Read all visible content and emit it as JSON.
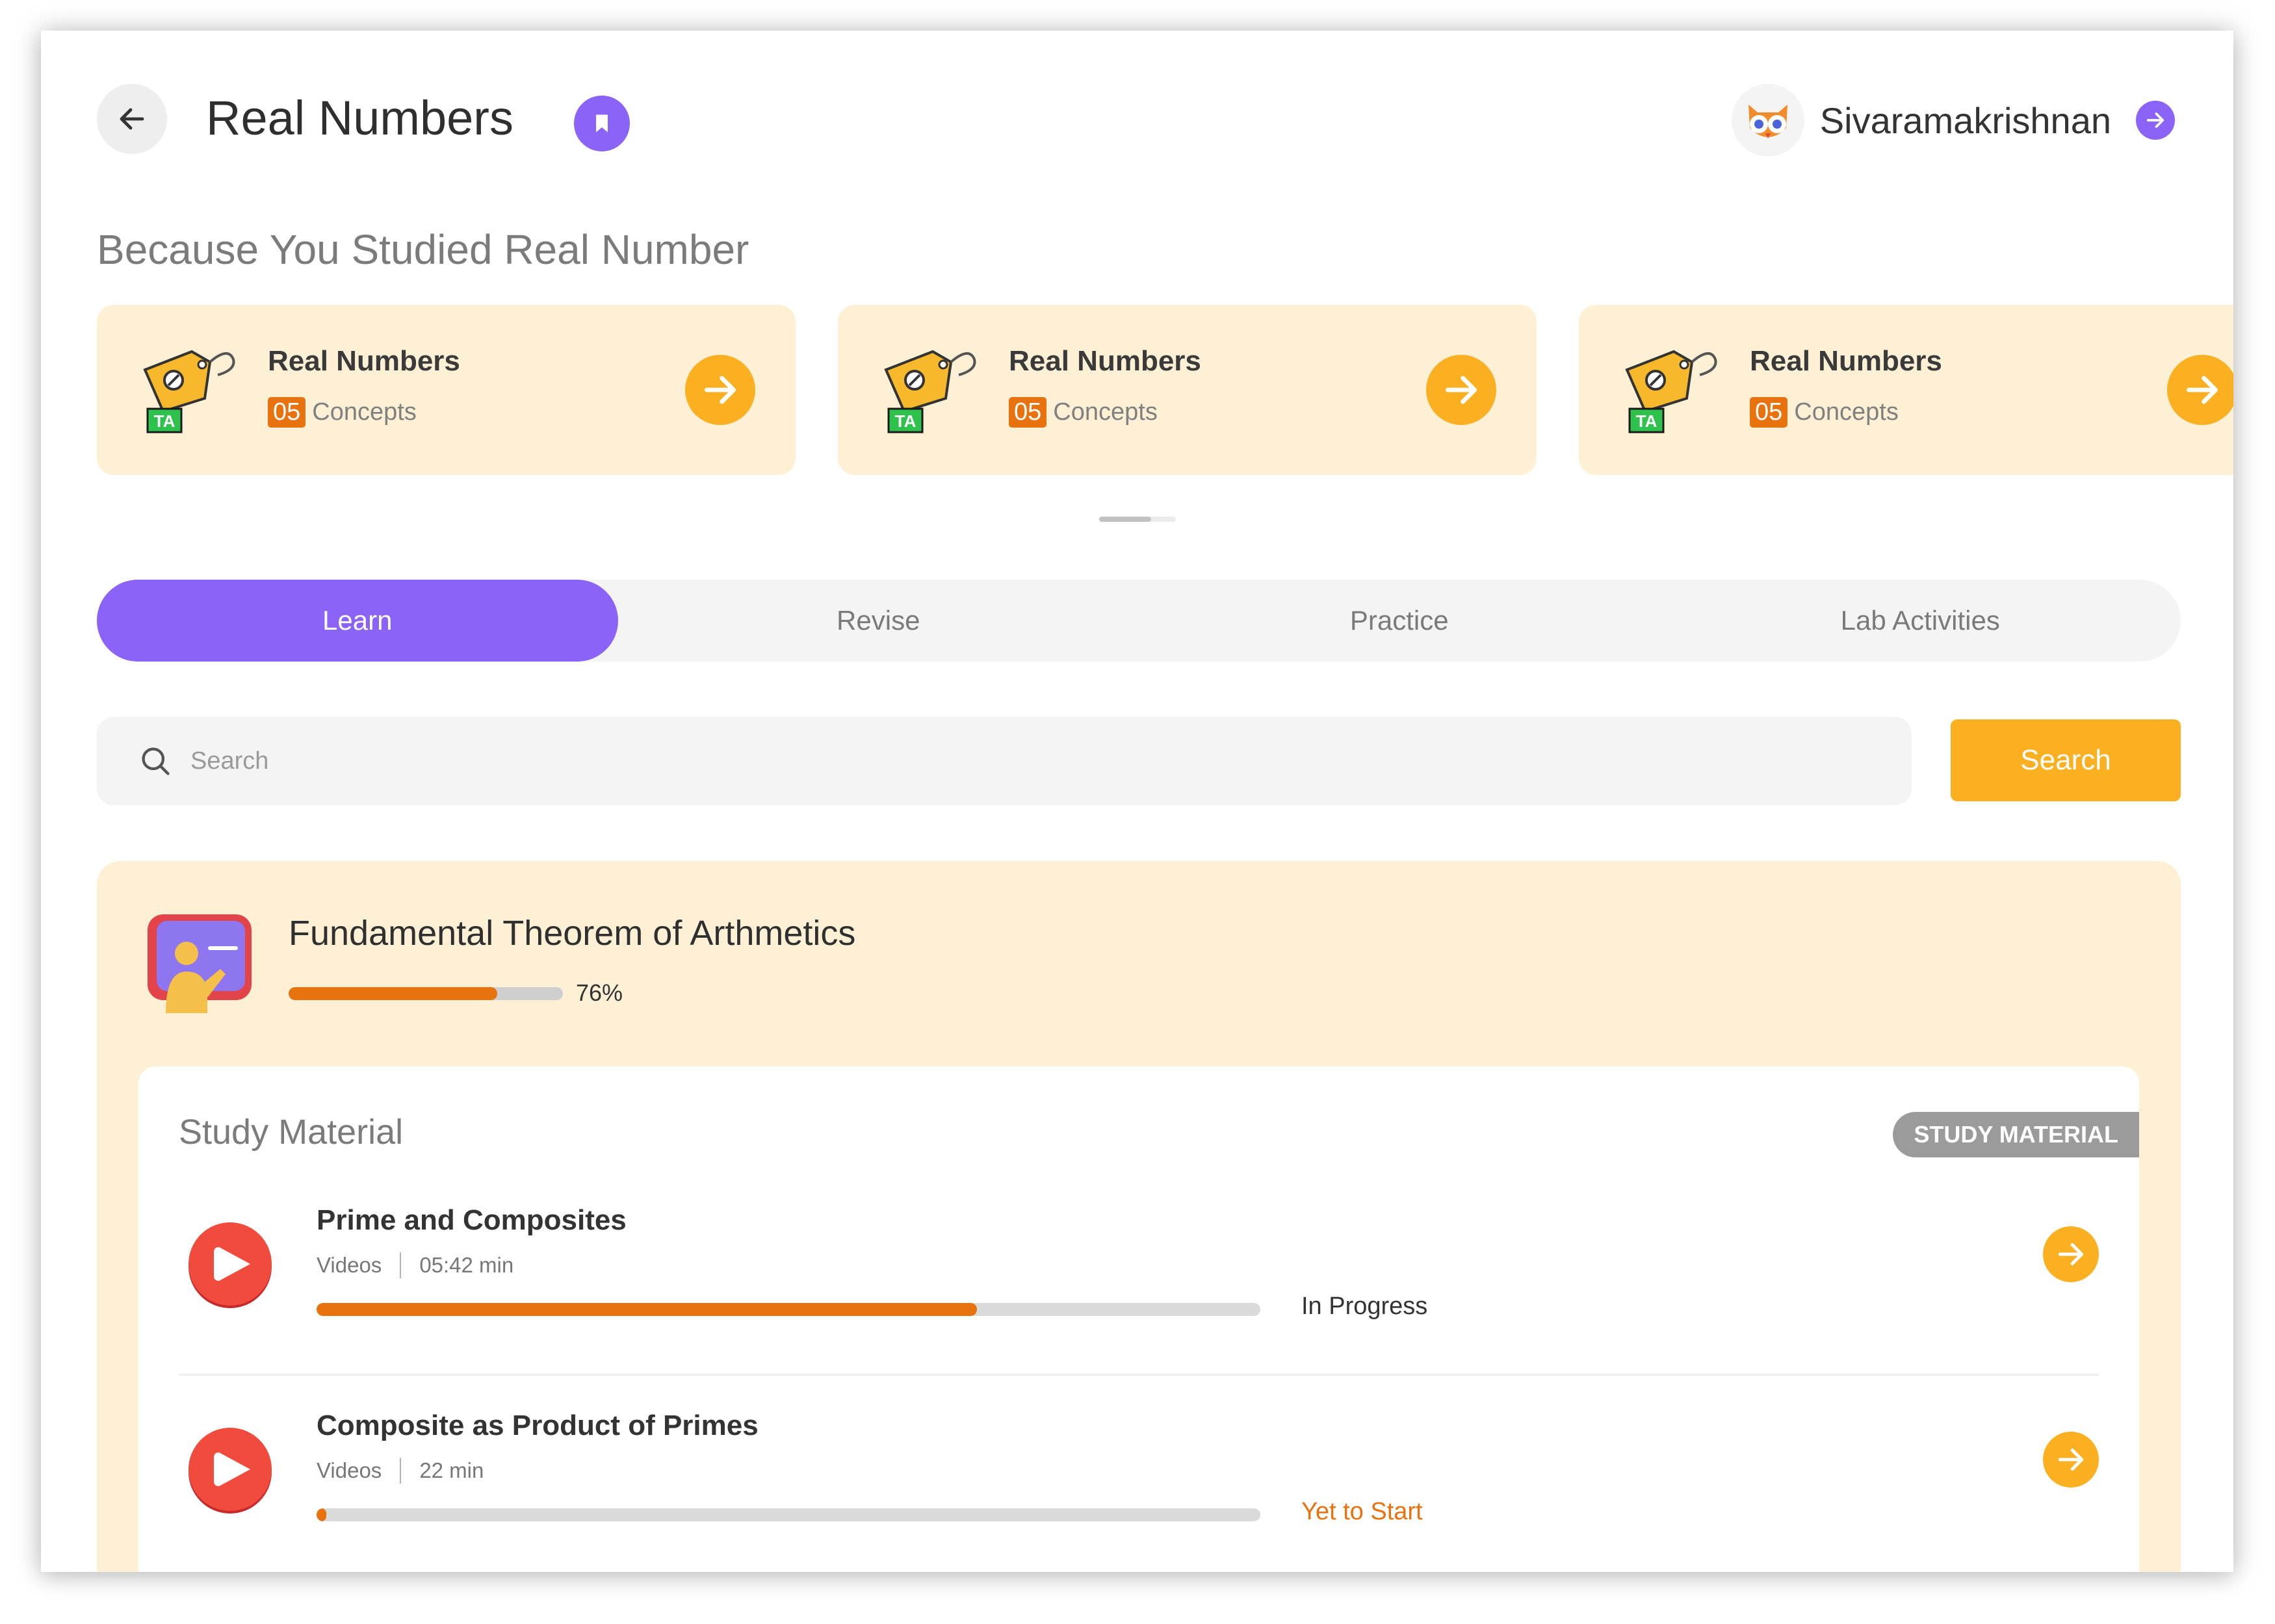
{
  "header": {
    "title": "Real Numbers",
    "user_name": "Sivaramakrishnan"
  },
  "recommendations": {
    "title": "Because You Studied Real Number",
    "icon_label": "TA",
    "cards": [
      {
        "name": "Real Numbers",
        "count": "05",
        "unit": "Concepts"
      },
      {
        "name": "Real Numbers",
        "count": "05",
        "unit": "Concepts"
      },
      {
        "name": "Real Numbers",
        "count": "05",
        "unit": "Concepts"
      }
    ]
  },
  "tabs": [
    {
      "label": "Learn",
      "active": true
    },
    {
      "label": "Revise",
      "active": false
    },
    {
      "label": "Practice",
      "active": false
    },
    {
      "label": "Lab Activities",
      "active": false
    }
  ],
  "search": {
    "placeholder": "Search",
    "value": "",
    "button_label": "Search"
  },
  "topic": {
    "title": "Fundamental Theorem of Arthmetics",
    "progress": 76,
    "progress_label": "76%"
  },
  "study_material": {
    "title": "Study Material",
    "tag": "STUDY MATERIAL",
    "items": [
      {
        "name": "Prime and Composites",
        "type": "Videos",
        "duration": "05:42 min",
        "progress": 70,
        "status": "In Progress"
      },
      {
        "name": "Composite as Product of Primes",
        "type": "Videos",
        "duration": "22 min",
        "progress": 1,
        "status": "Yet to Start"
      }
    ]
  },
  "colors": {
    "accent_purple": "#8b63f8",
    "accent_yellow": "#fbb022",
    "accent_orange": "#e8730e",
    "card_bg": "#fdf0d5"
  },
  "icons": {
    "back": "arrow-left-icon",
    "bookmark": "bookmark-icon",
    "user_go": "arrow-right-circle-icon",
    "search": "search-icon",
    "card": "price-tag-icon",
    "topic": "teacher-board-icon",
    "item": "play-icon"
  }
}
